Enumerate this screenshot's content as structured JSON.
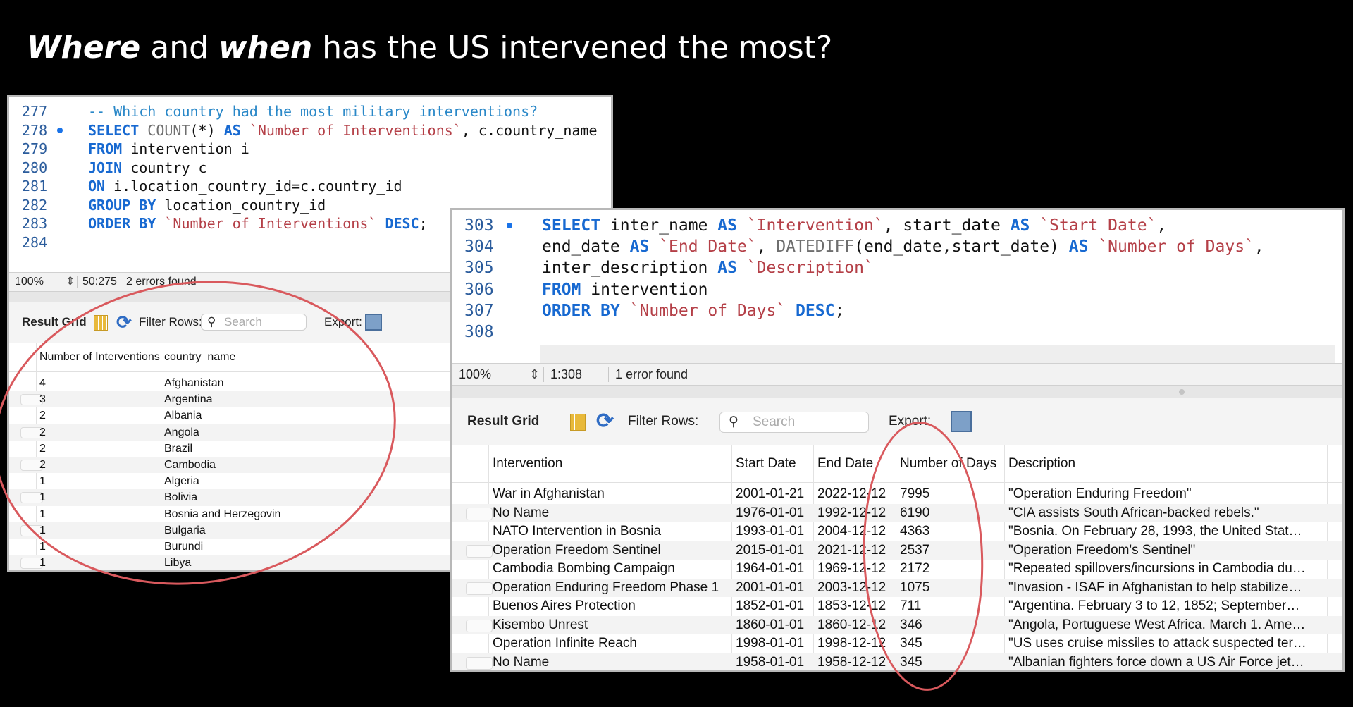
{
  "slide": {
    "title_emph1": "Where",
    "title_mid": " and ",
    "title_emph2": "when",
    "title_rest": " has the US intervened the most?"
  },
  "window1": {
    "code_lines": [
      {
        "num": "277",
        "bp": false,
        "tokens": [
          {
            "t": "-- Which country had the most military interventions?",
            "c": "cmt"
          }
        ]
      },
      {
        "num": "278",
        "bp": true,
        "tokens": [
          {
            "t": "SELECT ",
            "c": "kw"
          },
          {
            "t": "COUNT",
            "c": "fn"
          },
          {
            "t": "(*) ",
            "c": "plain"
          },
          {
            "t": "AS ",
            "c": "kw"
          },
          {
            "t": "`Number of Interventions`",
            "c": "str"
          },
          {
            "t": ", c.country_name",
            "c": "plain"
          }
        ]
      },
      {
        "num": "279",
        "bp": false,
        "tokens": [
          {
            "t": "FROM ",
            "c": "kw"
          },
          {
            "t": "intervention i",
            "c": "plain"
          }
        ]
      },
      {
        "num": "280",
        "bp": false,
        "tokens": [
          {
            "t": "JOIN ",
            "c": "kw"
          },
          {
            "t": "country c",
            "c": "plain"
          }
        ]
      },
      {
        "num": "281",
        "bp": false,
        "tokens": [
          {
            "t": "ON ",
            "c": "kw"
          },
          {
            "t": "i.location_country_id=c.country_id",
            "c": "plain"
          }
        ]
      },
      {
        "num": "282",
        "bp": false,
        "tokens": [
          {
            "t": "GROUP BY ",
            "c": "kw"
          },
          {
            "t": "location_country_id",
            "c": "plain"
          }
        ]
      },
      {
        "num": "283",
        "bp": false,
        "tokens": [
          {
            "t": "ORDER BY ",
            "c": "kw"
          },
          {
            "t": "`Number of Interventions`",
            "c": "str"
          },
          {
            "t": " DESC",
            "c": "kw"
          },
          {
            "t": ";",
            "c": "plain"
          }
        ]
      },
      {
        "num": "284",
        "bp": false,
        "tokens": []
      }
    ],
    "status": {
      "zoom": "100%",
      "position": "50:275",
      "errors": "2 errors found"
    },
    "toolbar": {
      "result_grid": "Result Grid",
      "filter_rows": "Filter Rows:",
      "search_placeholder": "Search",
      "export": "Export:"
    },
    "columns": [
      "Number of Interventions",
      "country_name"
    ],
    "rows": [
      [
        "4",
        "Afghanistan"
      ],
      [
        "3",
        "Argentina"
      ],
      [
        "2",
        "Albania"
      ],
      [
        "2",
        "Angola"
      ],
      [
        "2",
        "Brazil"
      ],
      [
        "2",
        "Cambodia"
      ],
      [
        "1",
        "Algeria"
      ],
      [
        "1",
        "Bolivia"
      ],
      [
        "1",
        "Bosnia and Herzegovina"
      ],
      [
        "1",
        "Bulgaria"
      ],
      [
        "1",
        "Burundi"
      ],
      [
        "1",
        "Libya"
      ]
    ]
  },
  "window2": {
    "code_lines": [
      {
        "num": "303",
        "bp": true,
        "tokens": [
          {
            "t": "SELECT ",
            "c": "kw"
          },
          {
            "t": "inter_name ",
            "c": "plain"
          },
          {
            "t": "AS ",
            "c": "kw"
          },
          {
            "t": "`Intervention`",
            "c": "str"
          },
          {
            "t": ", start_date ",
            "c": "plain"
          },
          {
            "t": "AS ",
            "c": "kw"
          },
          {
            "t": "`Start Date`",
            "c": "str"
          },
          {
            "t": ",",
            "c": "plain"
          }
        ]
      },
      {
        "num": "304",
        "bp": false,
        "tokens": [
          {
            "t": "end_date ",
            "c": "plain"
          },
          {
            "t": "AS ",
            "c": "kw"
          },
          {
            "t": "`End Date`",
            "c": "str"
          },
          {
            "t": ", ",
            "c": "plain"
          },
          {
            "t": "DATEDIFF",
            "c": "fn"
          },
          {
            "t": "(end_date,start_date) ",
            "c": "plain"
          },
          {
            "t": "AS ",
            "c": "kw"
          },
          {
            "t": "`Number of Days`",
            "c": "str"
          },
          {
            "t": ",",
            "c": "plain"
          }
        ]
      },
      {
        "num": "305",
        "bp": false,
        "tokens": [
          {
            "t": "inter_description ",
            "c": "plain"
          },
          {
            "t": "AS ",
            "c": "kw"
          },
          {
            "t": "`Description`",
            "c": "str"
          }
        ]
      },
      {
        "num": "306",
        "bp": false,
        "tokens": [
          {
            "t": "FROM ",
            "c": "kw"
          },
          {
            "t": "intervention",
            "c": "plain"
          }
        ]
      },
      {
        "num": "307",
        "bp": false,
        "tokens": [
          {
            "t": "ORDER BY ",
            "c": "kw"
          },
          {
            "t": "`Number of Days`",
            "c": "str"
          },
          {
            "t": " DESC",
            "c": "kw"
          },
          {
            "t": ";",
            "c": "plain"
          }
        ]
      },
      {
        "num": "308",
        "bp": false,
        "tokens": []
      }
    ],
    "status": {
      "zoom": "100%",
      "position": "1:308",
      "errors": "1 error found"
    },
    "toolbar": {
      "result_grid": "Result Grid",
      "filter_rows": "Filter Rows:",
      "search_placeholder": "Search",
      "export": "Export:"
    },
    "columns": [
      "Intervention",
      "Start Date",
      "End Date",
      "Number of Days",
      "Description"
    ],
    "rows": [
      [
        "War in Afghanistan",
        "2001-01-21",
        "2022-12-12",
        "7995",
        "\"Operation Enduring Freedom\""
      ],
      [
        "No Name",
        "1976-01-01",
        "1992-12-12",
        "6190",
        "\"CIA assists South African-backed rebels.\""
      ],
      [
        "NATO Intervention in Bosnia",
        "1993-01-01",
        "2004-12-12",
        "4363",
        "\"Bosnia. On February 28, 1993, the United Stat…"
      ],
      [
        "Operation Freedom Sentinel",
        "2015-01-01",
        "2021-12-12",
        "2537",
        "\"Operation Freedom's Sentinel\""
      ],
      [
        "Cambodia Bombing Campaign",
        "1964-01-01",
        "1969-12-12",
        "2172",
        "\"Repeated spillovers/incursions in Cambodia du…"
      ],
      [
        "Operation Enduring Freedom Phase 1",
        "2001-01-01",
        "2003-12-12",
        "1075",
        "\"Invasion - ISAF in Afghanistan to help stabilize…"
      ],
      [
        "Buenos Aires Protection",
        "1852-01-01",
        "1853-12-12",
        "711",
        "\"Argentina. February 3 to 12, 1852; September…"
      ],
      [
        "Kisembo Unrest",
        "1860-01-01",
        "1860-12-12",
        "346",
        "\"Angola, Portuguese West Africa. March 1. Ame…"
      ],
      [
        "Operation Infinite Reach",
        "1998-01-01",
        "1998-12-12",
        "345",
        "\"US uses cruise missiles to attack suspected ter…"
      ],
      [
        "No Name",
        "1958-01-01",
        "1958-12-12",
        "345",
        "\"Albanian fighters force down a US Air Force jet…"
      ]
    ]
  }
}
